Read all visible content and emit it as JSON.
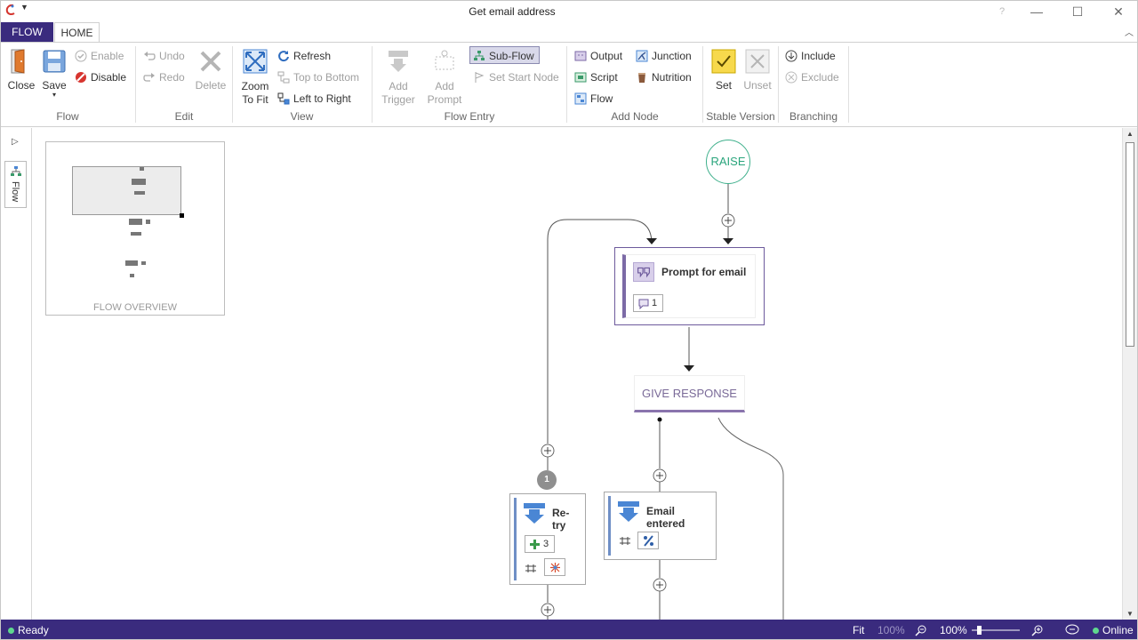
{
  "window": {
    "title": "Get email address",
    "help": "?",
    "minimize": "—",
    "maximize": "☐",
    "close": "✕"
  },
  "tabs": {
    "flow": "FLOW",
    "home": "HOME"
  },
  "ribbon": {
    "flow_group": {
      "label": "Flow",
      "close": "Close",
      "save": "Save",
      "save_caret": "▾",
      "enable": "Enable",
      "disable": "Disable"
    },
    "edit_group": {
      "label": "Edit",
      "undo": "Undo",
      "redo": "Redo",
      "delete": "Delete"
    },
    "view_group": {
      "label": "View",
      "zoom_line1": "Zoom",
      "zoom_line2": "To Fit",
      "refresh": "Refresh",
      "top_to_bottom": "Top to Bottom",
      "left_to_right": "Left to Right"
    },
    "flow_entry_group": {
      "label": "Flow Entry",
      "add_trigger_line1": "Add",
      "add_trigger_line2": "Trigger",
      "add_prompt_line1": "Add",
      "add_prompt_line2": "Prompt",
      "sub_flow": "Sub-Flow",
      "set_start_node": "Set Start Node"
    },
    "add_node_group": {
      "label": "Add Node",
      "output": "Output",
      "script": "Script",
      "flow": "Flow",
      "junction": "Junction",
      "nutrition": "Nutrition"
    },
    "stable_group": {
      "label": "Stable Version",
      "set": "Set",
      "unset": "Unset"
    },
    "branching_group": {
      "label": "Branching",
      "include": "Include",
      "exclude": "Exclude"
    }
  },
  "sidebar": {
    "flow_tab": "Flow"
  },
  "overview": {
    "label": "FLOW OVERVIEW"
  },
  "canvas": {
    "raise": "RAISE",
    "prompt_node": {
      "title": "Prompt for email",
      "count": "1"
    },
    "give_response": "GIVE RESPONSE",
    "branch_number": "1",
    "retry_node": {
      "title": "Re-try",
      "count": "3"
    },
    "email_node": {
      "title": "Email entered"
    }
  },
  "status": {
    "ready": "Ready",
    "fit": "Fit",
    "zoom_fit_value": "100%",
    "zoom_value": "100%",
    "online": "Online"
  },
  "colors": {
    "brand": "#3a2b7e",
    "raise_green": "#2aa57c",
    "prompt_purple": "#7c6aa6",
    "action_blue": "#4a86d4"
  }
}
